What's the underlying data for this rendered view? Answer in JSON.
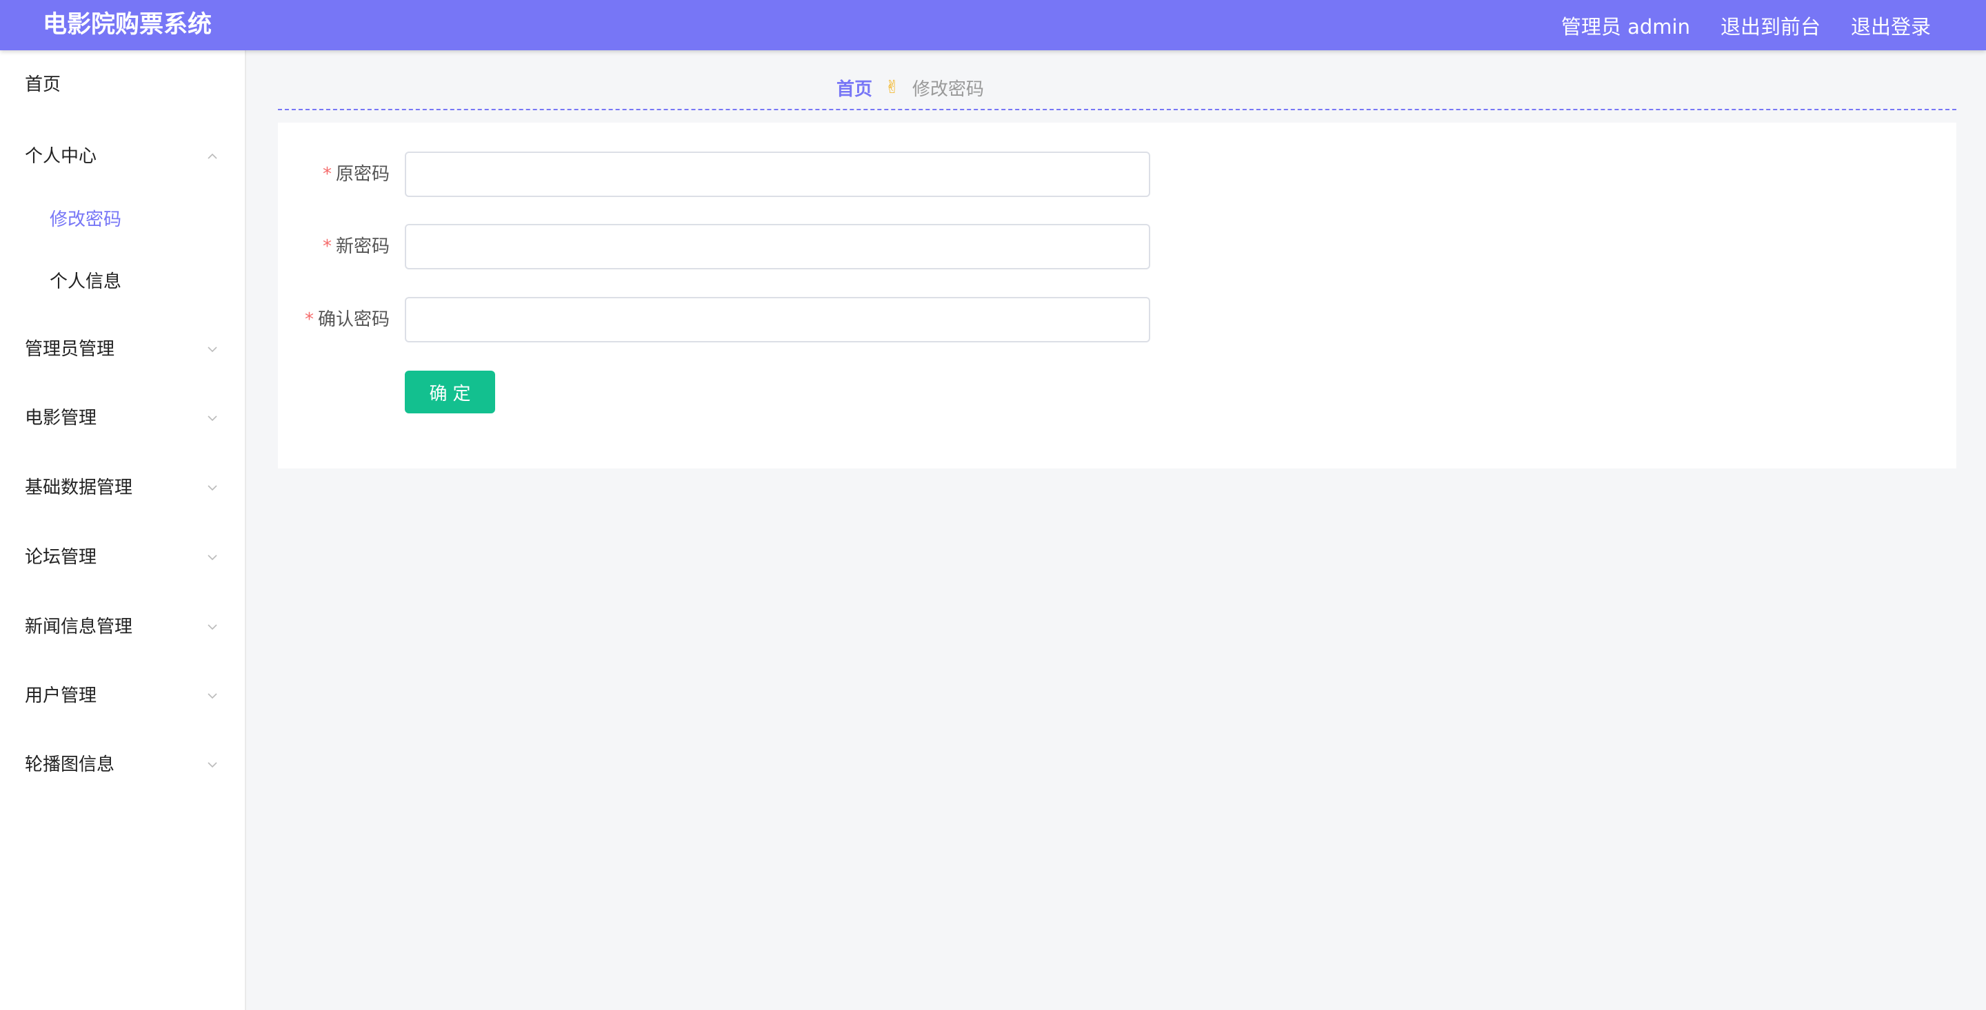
{
  "header": {
    "app_title": "电影院购票系统",
    "admin_label": "管理员 admin",
    "to_front_label": "退出到前台",
    "logout_label": "退出登录",
    "accent_color": "#7776f6"
  },
  "sidebar": {
    "items": [
      {
        "label": "首页",
        "expandable": false
      },
      {
        "label": "个人中心",
        "expandable": true,
        "expanded": true,
        "children": [
          {
            "label": "修改密码",
            "active": true
          },
          {
            "label": "个人信息",
            "active": false
          }
        ]
      },
      {
        "label": "管理员管理",
        "expandable": true,
        "expanded": false
      },
      {
        "label": "电影管理",
        "expandable": true,
        "expanded": false
      },
      {
        "label": "基础数据管理",
        "expandable": true,
        "expanded": false
      },
      {
        "label": "论坛管理",
        "expandable": true,
        "expanded": false
      },
      {
        "label": "新闻信息管理",
        "expandable": true,
        "expanded": false
      },
      {
        "label": "用户管理",
        "expandable": true,
        "expanded": false
      },
      {
        "label": "轮播图信息",
        "expandable": true,
        "expanded": false
      }
    ]
  },
  "breadcrumb": {
    "home": "首页",
    "separator_icon": "victory-hand-icon",
    "separator_glyph": "✌",
    "current": "修改密码"
  },
  "form": {
    "required_mark": "*",
    "fields": [
      {
        "label": "原密码",
        "value": "",
        "placeholder": ""
      },
      {
        "label": "新密码",
        "value": "",
        "placeholder": ""
      },
      {
        "label": "确认密码",
        "value": "",
        "placeholder": ""
      }
    ],
    "submit_label": "确定",
    "submit_color": "#13c08f"
  }
}
